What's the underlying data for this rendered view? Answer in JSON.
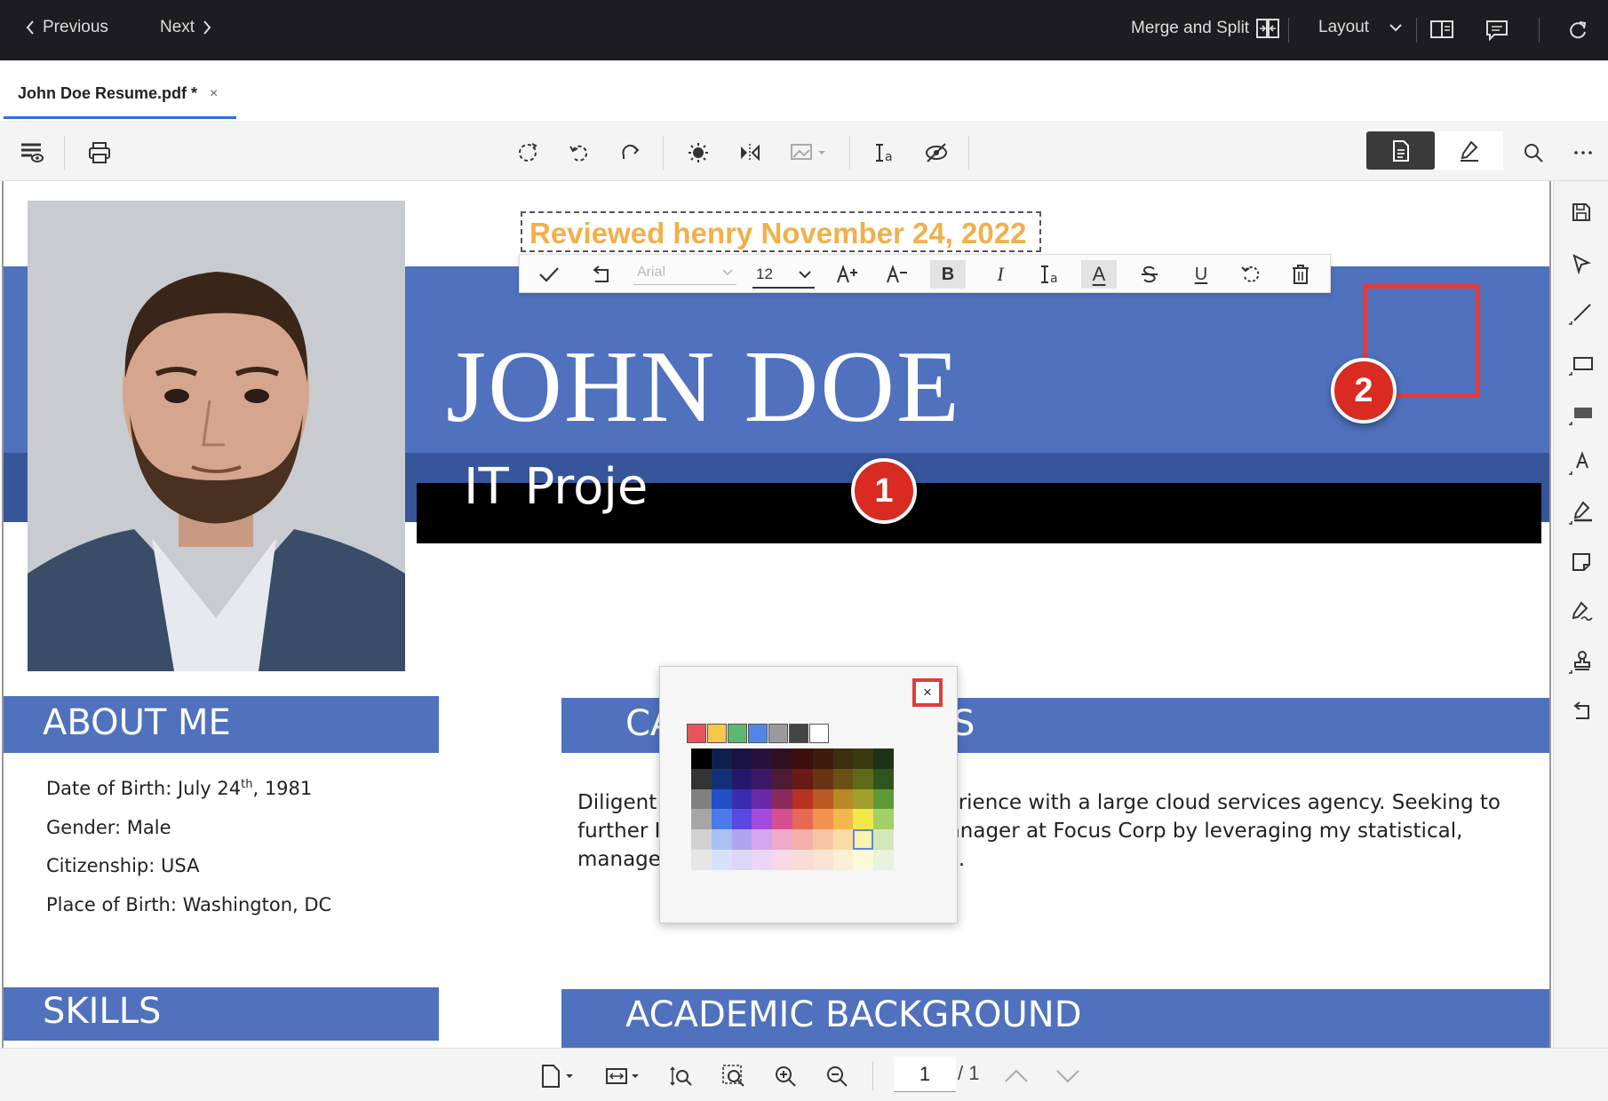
{
  "topbar": {
    "previous_label": "Previous",
    "next_label": "Next",
    "merge_split_label": "Merge and Split",
    "layout_label": "Layout"
  },
  "tab": {
    "title": "John Doe Resume.pdf *",
    "close": "×"
  },
  "stamp": {
    "text": "Reviewed henry November 24, 2022"
  },
  "format_toolbar": {
    "font_family": "Arial",
    "font_size": "12",
    "bold": "B",
    "italic": "I",
    "underline": "U",
    "font_color": "A"
  },
  "resume": {
    "name": "JOHN DOE",
    "job_title": "IT Proje",
    "about_heading": "ABOUT ME",
    "career_heading_left": "CA",
    "career_heading_right": "S",
    "skills_heading": "SKILLS",
    "academic_heading": "ACADEMIC BACKGROUND",
    "dob_label": "Date of Birth: July 24",
    "dob_sup": "th",
    "dob_year": ", 1981",
    "gender": "Gender: Male",
    "citizenship": "Citizenship: USA",
    "place_of_birth": "Place of Birth: Washington, DC",
    "objective_line1": "Diligent Manager with 2+ years experience with a large cloud services agency. Seeking to",
    "objective_line2": "further IT career as a Department Manager at Focus Corp  by leveraging my statistical,",
    "objective_line3": "managerial and communicative skills."
  },
  "color_picker": {
    "close": "×",
    "quick_colors": [
      "#e8555a",
      "#f5c74a",
      "#5cb870",
      "#4f86e8",
      "#9a9a9a",
      "#444444",
      "#ffffff"
    ],
    "grid_columns": [
      [
        "#000000",
        "#333333",
        "#808080",
        "#a6a6a6",
        "#d2d2d2",
        "#e6e6e6"
      ],
      [
        "#0f1f4d",
        "#12307a",
        "#2050c8",
        "#4a7be8",
        "#a9c2f3",
        "#d7e2fa"
      ],
      [
        "#1a1240",
        "#22196a",
        "#3a2cb0",
        "#5a48e2",
        "#b0a4f0",
        "#dcd6f8"
      ],
      [
        "#28113d",
        "#3d1867",
        "#6a2aa8",
        "#a44ae0",
        "#d6a6f0",
        "#ecd6f8"
      ],
      [
        "#30111f",
        "#4e1a36",
        "#8a2a5c",
        "#d65091",
        "#eeaac8",
        "#f6d8e6"
      ],
      [
        "#3d0e0c",
        "#6a1a14",
        "#b83224",
        "#e86856",
        "#f3b0a6",
        "#f9dcd6"
      ],
      [
        "#3d1c0e",
        "#6a3314",
        "#b85a22",
        "#f09250",
        "#f6c6a4",
        "#fae4d4"
      ],
      [
        "#3d2e0e",
        "#6a5014",
        "#b88a24",
        "#f2b84a",
        "#f8dca4",
        "#fcefd6"
      ],
      [
        "#383a10",
        "#5e6a18",
        "#a0a02a",
        "#f2e84a",
        "#fbf4b0",
        "#fdfadc"
      ],
      [
        "#1e3314",
        "#30541e",
        "#5e9a38",
        "#a2d068",
        "#d2e8b6",
        "#e8f2dc"
      ]
    ],
    "selected": "#fbf4b0"
  },
  "badges": {
    "one": "1",
    "two": "2"
  },
  "bottom": {
    "page_current": "1",
    "page_total": "/ 1"
  }
}
